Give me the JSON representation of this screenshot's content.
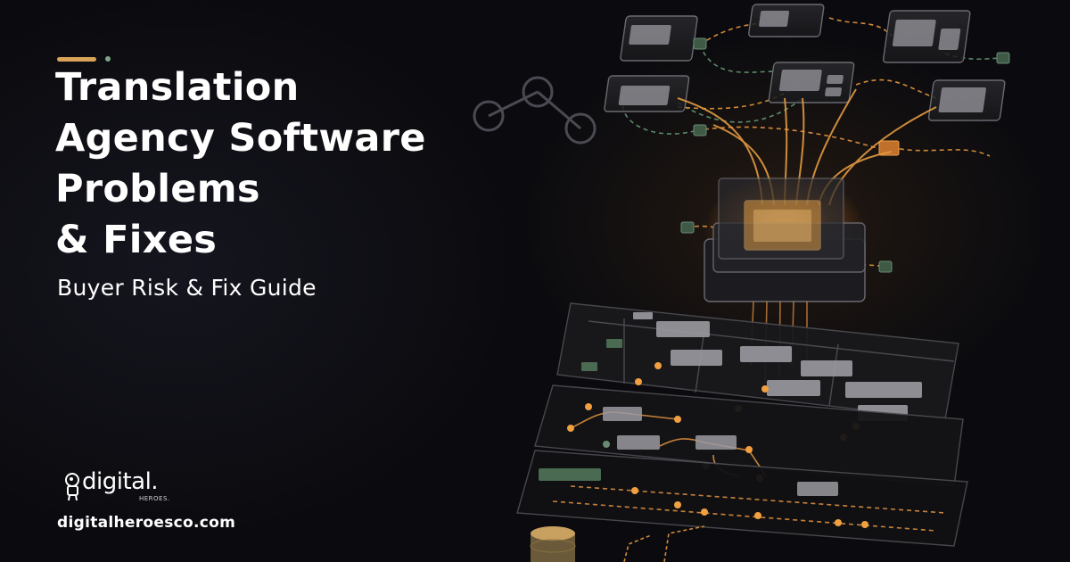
{
  "title_lines": [
    "Translation",
    "Agency Software",
    "Problems",
    "& Fixes"
  ],
  "subtitle": "Buyer Risk & Fix Guide",
  "brand": {
    "logo_word": "digital.",
    "logo_sub": "HEROES.",
    "url": "digitalheroesco.com"
  },
  "colors": {
    "background": "#0b0b0f",
    "accent_gold": "#d9a45a",
    "accent_orange": "#f0a040",
    "accent_green": "#7fa58a",
    "text": "#ffffff"
  },
  "icons": [
    "connected-nodes-icon",
    "astronaut-logo-icon",
    "database-cylinder-icon"
  ]
}
